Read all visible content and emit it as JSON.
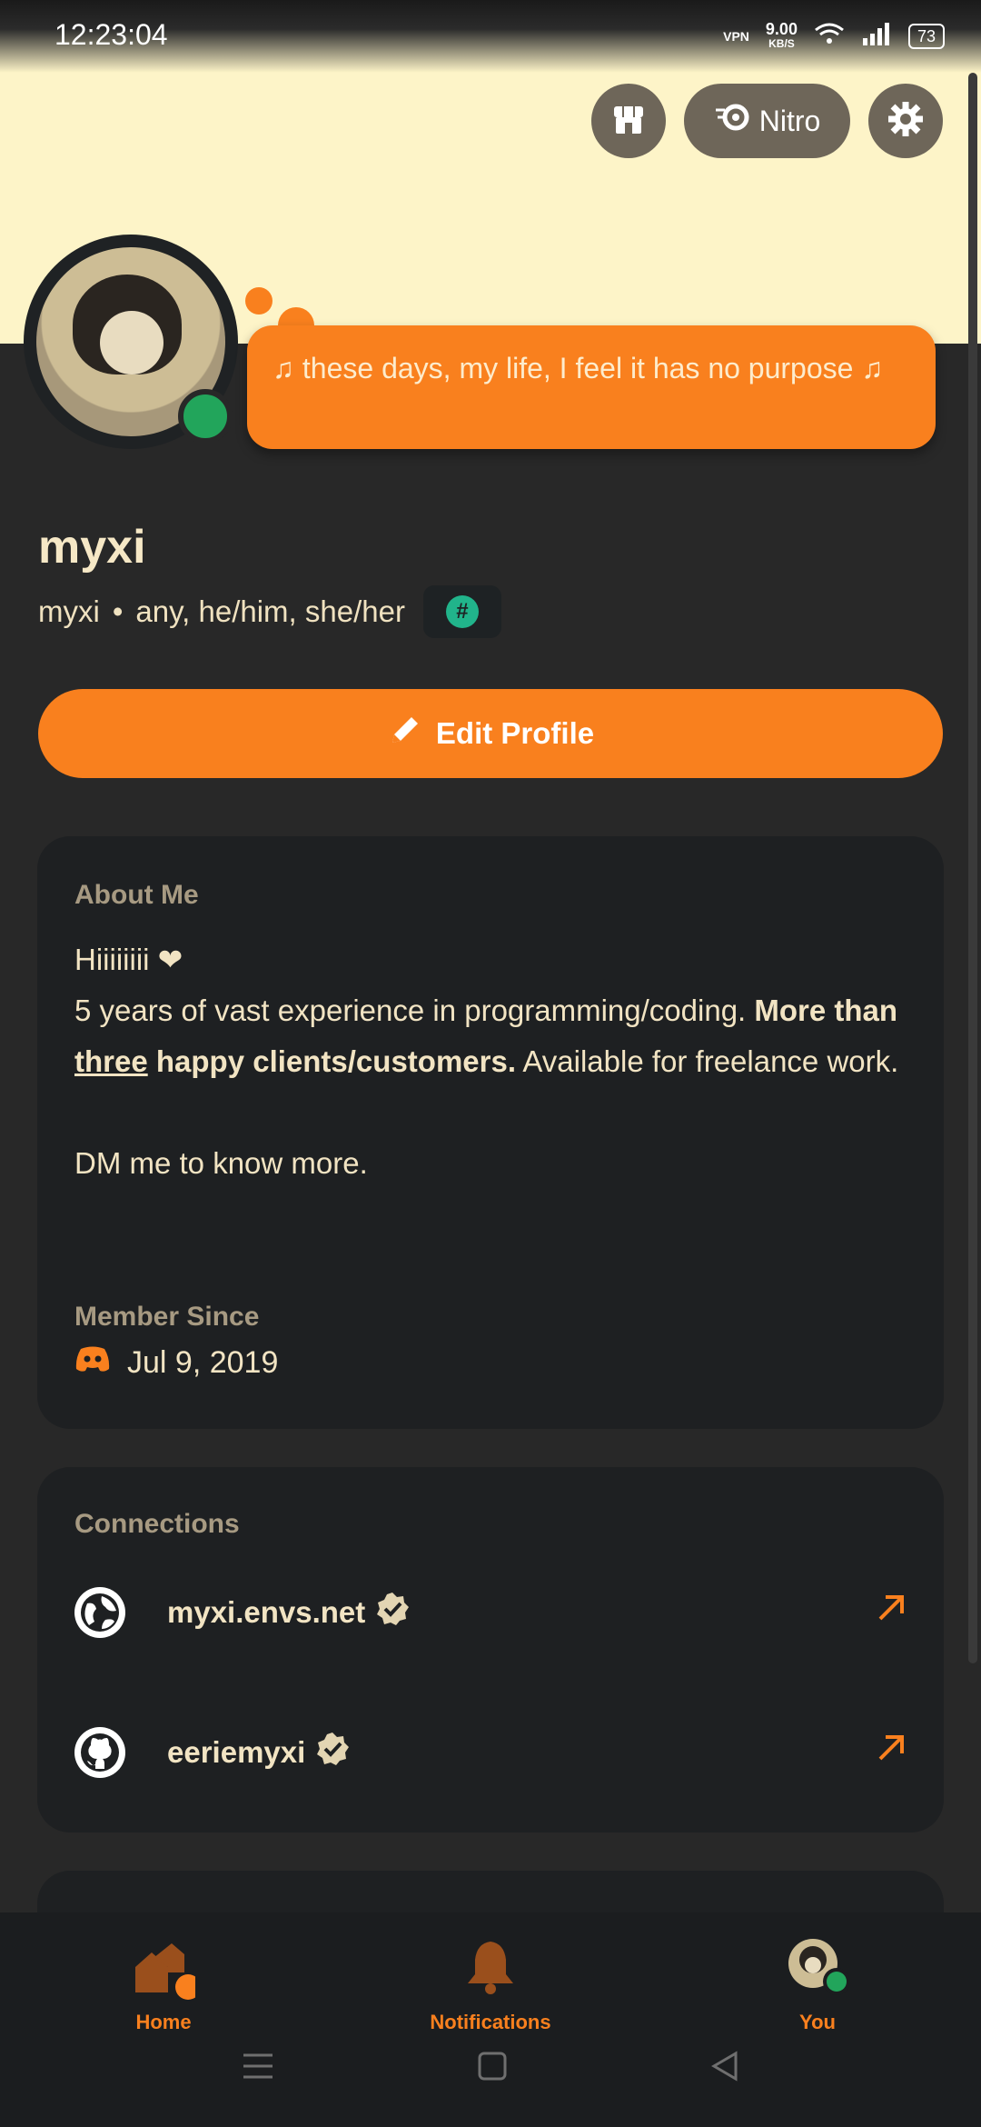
{
  "status_bar": {
    "time": "12:23:04",
    "vpn": "VPN",
    "net_speed": "9.00",
    "net_unit": "KB/S",
    "battery": "73"
  },
  "header": {
    "shop_icon": "shop-icon",
    "nitro_label": "Nitro",
    "settings_icon": "gear-icon"
  },
  "profile": {
    "status_text": "♫ these days, my life, I feel it has no purpose ♫",
    "display_name": "myxi",
    "username": "myxi",
    "separator": "•",
    "pronouns": "any, he/him, she/her",
    "badge": "#"
  },
  "actions": {
    "edit_profile": "Edit Profile"
  },
  "about": {
    "title": "About Me",
    "line1": "Hiiiiiiii ❤",
    "line2_a": "5 years of vast experience in programming/coding. ",
    "line2_b": "More than ",
    "line2_c": "three",
    "line2_d": " happy clients/customers.",
    "line2_e": " Available for freelance work.",
    "line3": "DM me to know more.",
    "member_since_title": "Member Since",
    "member_since_date": "Jul 9, 2019"
  },
  "connections": {
    "title": "Connections",
    "items": [
      {
        "name": "myxi.envs.net",
        "icon": "globe-icon"
      },
      {
        "name": "eeriemyxi",
        "icon": "github-icon"
      }
    ]
  },
  "nav": {
    "home": "Home",
    "notifications": "Notifications",
    "you": "You"
  },
  "colors": {
    "accent": "#f9801e",
    "banner": "#fdf4c8",
    "online": "#22a55b",
    "card": "#1e2022"
  }
}
